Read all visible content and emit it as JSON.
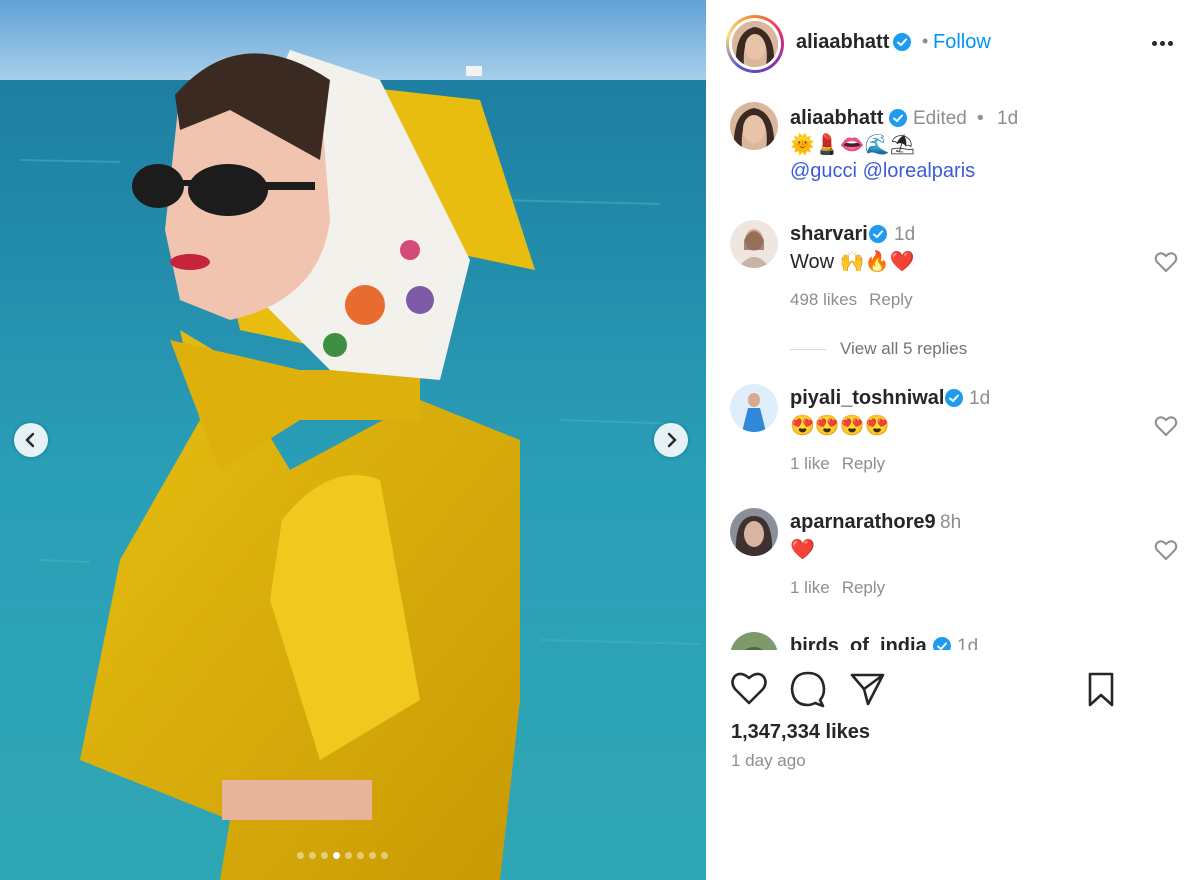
{
  "post": {
    "author": "aliaabhatt",
    "follow_label": "Follow",
    "separator": "•",
    "likes": "1,347,334 likes",
    "time_ago": "1 day ago"
  },
  "carousel": {
    "slide_count": 8,
    "active_index": 3
  },
  "caption": {
    "username": "aliaabhatt",
    "edited": "Edited",
    "separator": "•",
    "time": "1d",
    "emojis": "🌞💄👄🌊⛱",
    "mention_1": "@gucci",
    "mention_2": "@lorealparis"
  },
  "comments": [
    {
      "username": "sharvari",
      "verified": true,
      "time": "1d",
      "text": "Wow 🙌🔥❤️",
      "likes": "498 likes",
      "reply": "Reply",
      "view_replies": "View all 5 replies"
    },
    {
      "username": "piyali_toshniwal",
      "verified": true,
      "time": "1d",
      "text": "😍😍😍😍",
      "likes": "1 like",
      "reply": "Reply"
    },
    {
      "username": "aparnarathore9",
      "verified": false,
      "time": "8h",
      "text": "❤️",
      "likes": "1 like",
      "reply": "Reply"
    },
    {
      "username": "birds_of_india",
      "verified": true,
      "time": "1d"
    }
  ],
  "icons": {
    "like": "heart-icon",
    "comment": "comment-icon",
    "share": "share-icon",
    "save": "bookmark-icon",
    "verified": "verified-badge-icon",
    "more": "more-options-icon"
  },
  "colors": {
    "link": "#0095f6",
    "verified": "#1d9bf0",
    "mention": "#3b5bdb",
    "muted": "#8e8e8e"
  }
}
